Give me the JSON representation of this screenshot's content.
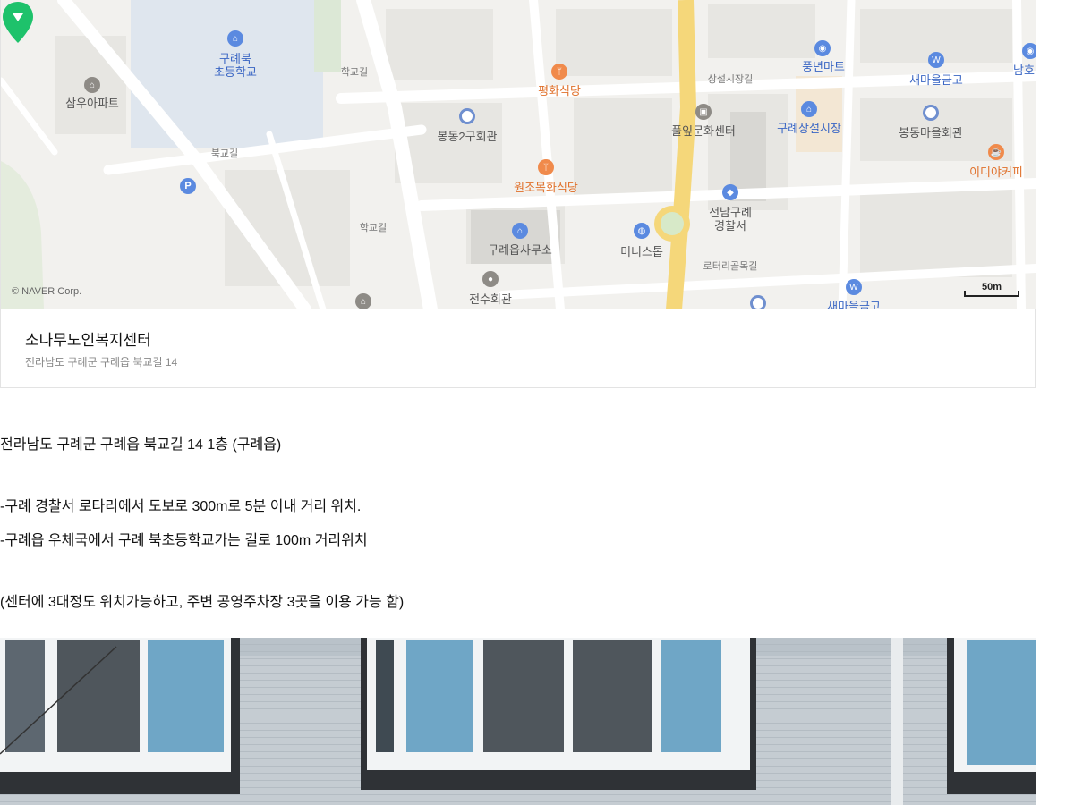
{
  "map": {
    "copyright": "© NAVER Corp.",
    "scale_label": "50m",
    "labels": {
      "school": "구례북\n초등학교",
      "apt": "삼우아파트",
      "hakgyo1": "학교길",
      "sangseol_road": "상설시장길",
      "pungnyeon": "풍년마트",
      "saemaeul1": "새마을금고",
      "namho": "남호",
      "pyeonghwa": "평화식당",
      "bongdong2": "봉동2구회관",
      "pulip": "풀잎문화센터",
      "market": "구례상설시장",
      "bongdong_hall": "봉동마을회관",
      "bukgyo": "북교길",
      "wonjo": "원조목화식당",
      "idiya": "이디야커피",
      "hakgyo2": "학교길",
      "police": "전남구례\n경찰서",
      "office": "구례읍사무소",
      "mini": "미니스톱",
      "rotary": "로터리골목길",
      "jeonsu": "전수회관",
      "saemaeul2": "새마을금고"
    }
  },
  "place": {
    "name": "소나무노인복지센터",
    "address": "전라남도 구례군 구례읍 북교길 14"
  },
  "content": {
    "line1": "전라남도 구례군 구례읍 북교길 14 1층 (구례읍)",
    "line2": "-구례 경찰서 로타리에서 도보로 300m로 5분 이내 거리 위치.",
    "line3": "-구례읍 우체국에서 구례 북초등학교가는 길로 100m 거리위치",
    "line4": "(센터에 3대정도 위치가능하고, 주변 공영주차장 3곳을 이용 가능 함)"
  }
}
